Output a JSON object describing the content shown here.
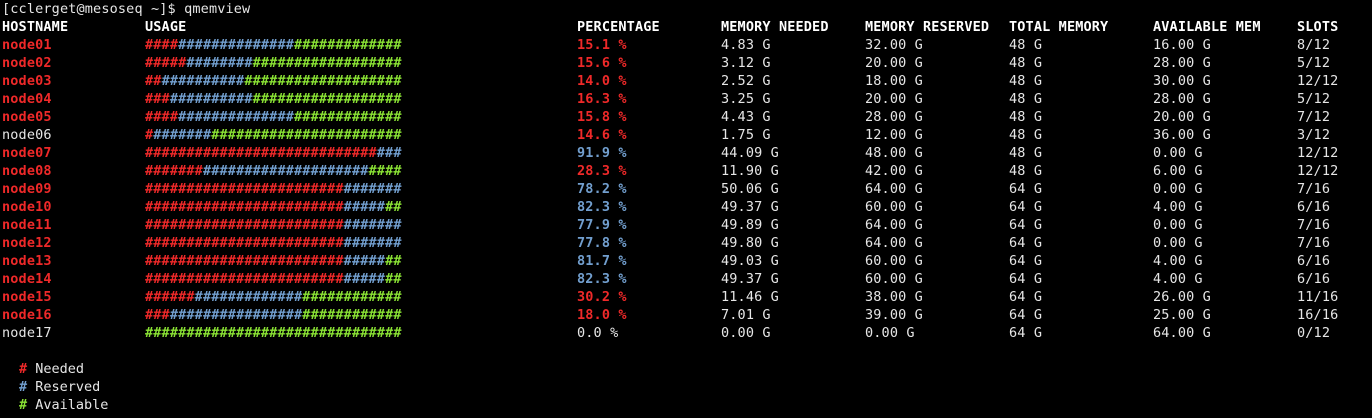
{
  "prompt": {
    "text": "[cclerget@mesoseq ~]$ qmemview"
  },
  "colors": {
    "needed": "#ef2929",
    "reserved": "#729fcf",
    "available": "#8ae234",
    "default": "#e6e6e6",
    "header": "#ffffff"
  },
  "headers": {
    "hostname": "HOSTNAME",
    "usage": "USAGE",
    "percentage": "PERCENTAGE",
    "memory_needed": "MEMORY NEEDED",
    "memory_reserved": "MEMORY RESERVED",
    "total_memory": "TOTAL MEMORY",
    "available_mem": "AVAILABLE MEM",
    "slots": "SLOTS"
  },
  "rows": [
    {
      "hostname": "node01",
      "status": "needed",
      "bar": {
        "needed": 4,
        "reserved": 14,
        "available": 13
      },
      "percentage": "15.1 %",
      "pct_status": "needed",
      "memory_needed": "4.83 G",
      "memory_reserved": "32.00 G",
      "total_memory": "48 G",
      "available_mem": "16.00 G",
      "slots": "8/12"
    },
    {
      "hostname": "node02",
      "status": "needed",
      "bar": {
        "needed": 5,
        "reserved": 8,
        "available": 18
      },
      "percentage": "15.6 %",
      "pct_status": "needed",
      "memory_needed": "3.12 G",
      "memory_reserved": "20.00 G",
      "total_memory": "48 G",
      "available_mem": "28.00 G",
      "slots": "5/12"
    },
    {
      "hostname": "node03",
      "status": "needed",
      "bar": {
        "needed": 2,
        "reserved": 10,
        "available": 19
      },
      "percentage": "14.0 %",
      "pct_status": "needed",
      "memory_needed": "2.52 G",
      "memory_reserved": "18.00 G",
      "total_memory": "48 G",
      "available_mem": "30.00 G",
      "slots": "12/12"
    },
    {
      "hostname": "node04",
      "status": "needed",
      "bar": {
        "needed": 3,
        "reserved": 10,
        "available": 18
      },
      "percentage": "16.3 %",
      "pct_status": "needed",
      "memory_needed": "3.25 G",
      "memory_reserved": "20.00 G",
      "total_memory": "48 G",
      "available_mem": "28.00 G",
      "slots": "5/12"
    },
    {
      "hostname": "node05",
      "status": "needed",
      "bar": {
        "needed": 4,
        "reserved": 14,
        "available": 13
      },
      "percentage": "15.8 %",
      "pct_status": "needed",
      "memory_needed": "4.43 G",
      "memory_reserved": "28.00 G",
      "total_memory": "48 G",
      "available_mem": "20.00 G",
      "slots": "7/12"
    },
    {
      "hostname": "node06",
      "status": "default",
      "bar": {
        "needed": 1,
        "reserved": 7,
        "available": 23
      },
      "percentage": "14.6 %",
      "pct_status": "needed",
      "memory_needed": "1.75 G",
      "memory_reserved": "12.00 G",
      "total_memory": "48 G",
      "available_mem": "36.00 G",
      "slots": "3/12"
    },
    {
      "hostname": "node07",
      "status": "needed",
      "bar": {
        "needed": 28,
        "reserved": 3,
        "available": 0
      },
      "percentage": "91.9 %",
      "pct_status": "reserved",
      "memory_needed": "44.09 G",
      "memory_reserved": "48.00 G",
      "total_memory": "48 G",
      "available_mem": "0.00 G",
      "slots": "12/12"
    },
    {
      "hostname": "node08",
      "status": "needed",
      "bar": {
        "needed": 7,
        "reserved": 20,
        "available": 4
      },
      "percentage": "28.3 %",
      "pct_status": "needed",
      "memory_needed": "11.90 G",
      "memory_reserved": "42.00 G",
      "total_memory": "48 G",
      "available_mem": "6.00 G",
      "slots": "12/12"
    },
    {
      "hostname": "node09",
      "status": "needed",
      "bar": {
        "needed": 24,
        "reserved": 7,
        "available": 0
      },
      "percentage": "78.2 %",
      "pct_status": "reserved",
      "memory_needed": "50.06 G",
      "memory_reserved": "64.00 G",
      "total_memory": "64 G",
      "available_mem": "0.00 G",
      "slots": "7/16"
    },
    {
      "hostname": "node10",
      "status": "needed",
      "bar": {
        "needed": 24,
        "reserved": 5,
        "available": 2
      },
      "percentage": "82.3 %",
      "pct_status": "reserved",
      "memory_needed": "49.37 G",
      "memory_reserved": "60.00 G",
      "total_memory": "64 G",
      "available_mem": "4.00 G",
      "slots": "6/16"
    },
    {
      "hostname": "node11",
      "status": "needed",
      "bar": {
        "needed": 24,
        "reserved": 7,
        "available": 0
      },
      "percentage": "77.9 %",
      "pct_status": "reserved",
      "memory_needed": "49.89 G",
      "memory_reserved": "64.00 G",
      "total_memory": "64 G",
      "available_mem": "0.00 G",
      "slots": "7/16"
    },
    {
      "hostname": "node12",
      "status": "needed",
      "bar": {
        "needed": 24,
        "reserved": 7,
        "available": 0
      },
      "percentage": "77.8 %",
      "pct_status": "reserved",
      "memory_needed": "49.80 G",
      "memory_reserved": "64.00 G",
      "total_memory": "64 G",
      "available_mem": "0.00 G",
      "slots": "7/16"
    },
    {
      "hostname": "node13",
      "status": "needed",
      "bar": {
        "needed": 24,
        "reserved": 5,
        "available": 2
      },
      "percentage": "81.7 %",
      "pct_status": "reserved",
      "memory_needed": "49.03 G",
      "memory_reserved": "60.00 G",
      "total_memory": "64 G",
      "available_mem": "4.00 G",
      "slots": "6/16"
    },
    {
      "hostname": "node14",
      "status": "needed",
      "bar": {
        "needed": 24,
        "reserved": 5,
        "available": 2
      },
      "percentage": "82.3 %",
      "pct_status": "reserved",
      "memory_needed": "49.37 G",
      "memory_reserved": "60.00 G",
      "total_memory": "64 G",
      "available_mem": "4.00 G",
      "slots": "6/16"
    },
    {
      "hostname": "node15",
      "status": "needed",
      "bar": {
        "needed": 6,
        "reserved": 13,
        "available": 12
      },
      "percentage": "30.2 %",
      "pct_status": "needed",
      "memory_needed": "11.46 G",
      "memory_reserved": "38.00 G",
      "total_memory": "64 G",
      "available_mem": "26.00 G",
      "slots": "11/16"
    },
    {
      "hostname": "node16",
      "status": "needed",
      "bar": {
        "needed": 3,
        "reserved": 16,
        "available": 12
      },
      "percentage": "18.0 %",
      "pct_status": "needed",
      "memory_needed": "7.01 G",
      "memory_reserved": "39.00 G",
      "total_memory": "64 G",
      "available_mem": "25.00 G",
      "slots": "16/16"
    },
    {
      "hostname": "node17",
      "status": "default",
      "bar": {
        "needed": 0,
        "reserved": 0,
        "available": 31
      },
      "percentage": "0.0 %",
      "pct_status": "default",
      "memory_needed": "0.00 G",
      "memory_reserved": "0.00 G",
      "total_memory": "64 G",
      "available_mem": "64.00 G",
      "slots": "0/12"
    }
  ],
  "legend": [
    {
      "mark": "#",
      "label": "Needed",
      "status": "needed"
    },
    {
      "mark": "#",
      "label": "Reserved",
      "status": "reserved"
    },
    {
      "mark": "#",
      "label": "Available",
      "status": "available"
    }
  ],
  "bar_char": "#"
}
